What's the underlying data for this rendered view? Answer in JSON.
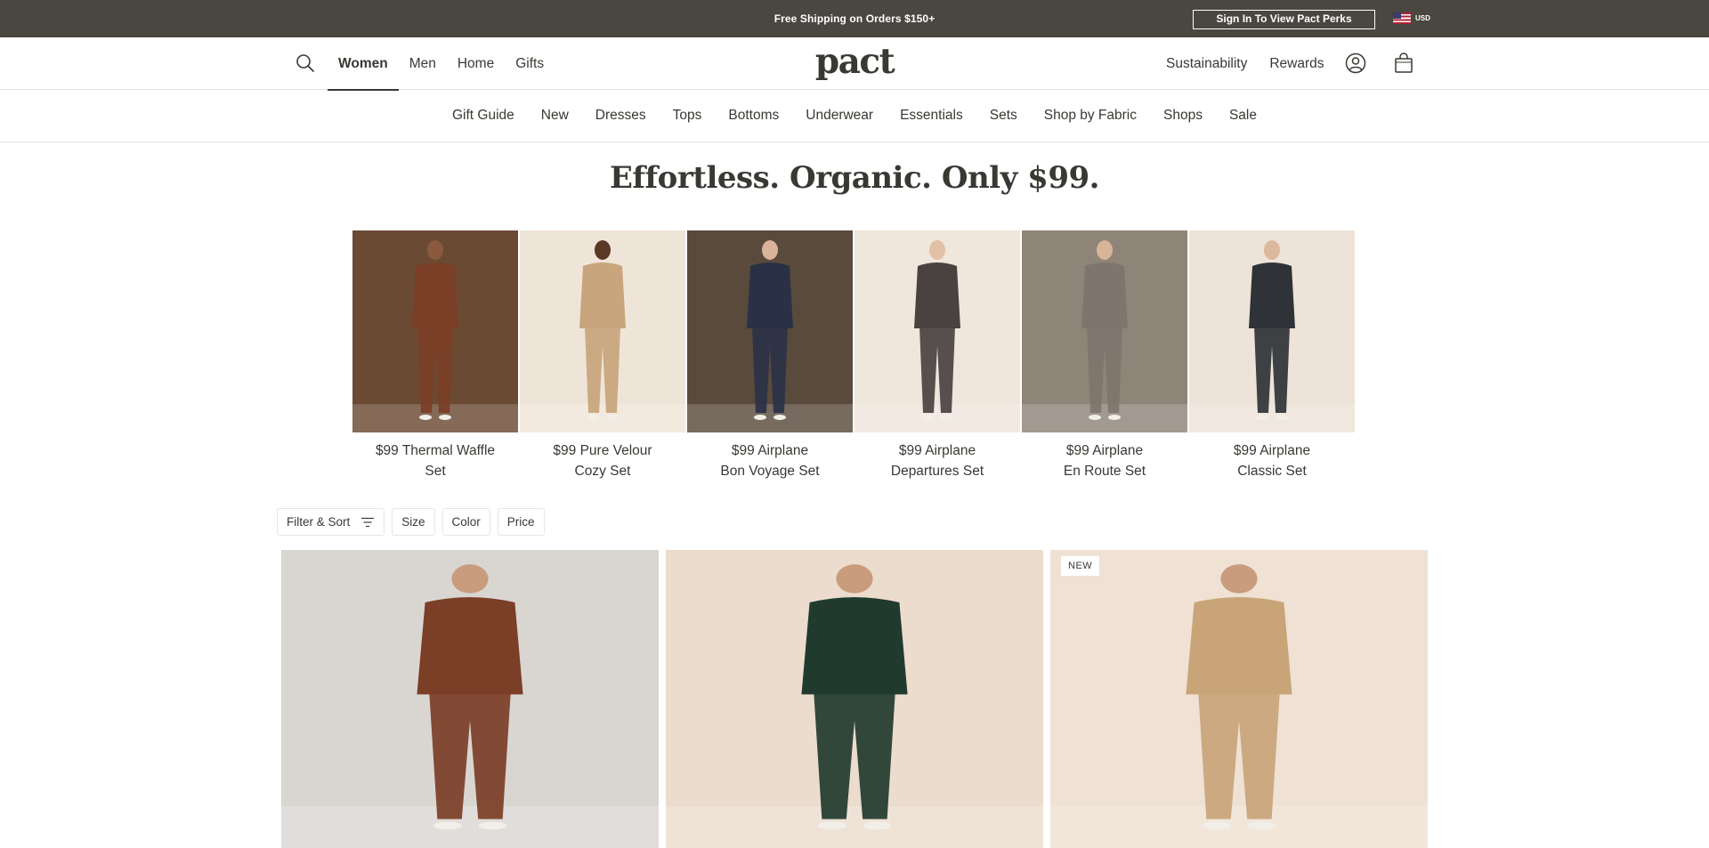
{
  "announcement": {
    "message": "Free Shipping on Orders $150+",
    "perks_button": "Sign In To View Pact Perks",
    "currency": "USD",
    "flag_icon": "us-flag-icon"
  },
  "header": {
    "logo": "pact",
    "main_nav": [
      {
        "label": "Women",
        "active": true
      },
      {
        "label": "Men",
        "active": false
      },
      {
        "label": "Home",
        "active": false
      },
      {
        "label": "Gifts",
        "active": false
      }
    ],
    "right_nav": [
      "Sustainability",
      "Rewards"
    ],
    "icons": {
      "search": "search-icon",
      "account": "account-icon",
      "cart": "shopping-bag-icon"
    }
  },
  "category_nav": [
    "Gift Guide",
    "New",
    "Dresses",
    "Tops",
    "Bottoms",
    "Underwear",
    "Essentials",
    "Sets",
    "Shop by Fabric",
    "Shops",
    "Sale"
  ],
  "hero": {
    "title": "Effortless. Organic. Only $99."
  },
  "features": [
    {
      "line1": "$99 Thermal Waffle",
      "line2": "Set",
      "bg": "#6a4a33",
      "outfit": "#7b3e26",
      "skin": "#8a5a3e"
    },
    {
      "line1": "$99 Pure Velour",
      "line2": "Cozy Set",
      "bg": "#efe4d8",
      "outfit": "#c8a57c",
      "skin": "#5a3826"
    },
    {
      "line1": "$99 Airplane",
      "line2": "Bon Voyage Set",
      "bg": "#5a4a3c",
      "outfit": "#2a3146",
      "skin": "#d9b49a"
    },
    {
      "line1": "$99 Airplane",
      "line2": "Departures Set",
      "bg": "#efe6dc",
      "outfit": "#4a4240",
      "skin": "#e2c0a4"
    },
    {
      "line1": "$99 Airplane",
      "line2": "En Route Set",
      "bg": "#8e8478",
      "outfit": "#7e756c",
      "skin": "#d8b498"
    },
    {
      "line1": "$99 Airplane",
      "line2": "Classic Set",
      "bg": "#ede3d8",
      "outfit": "#2f3337",
      "skin": "#dcb89c"
    }
  ],
  "filters": {
    "filter_sort": "Filter & Sort",
    "size": "Size",
    "color": "Color",
    "price": "Price"
  },
  "products": [
    {
      "badge": "",
      "bg": "#d9d6d2",
      "outfit": "#7b3e26"
    },
    {
      "badge": "",
      "bg": "#ecdcce",
      "outfit": "#213a2e"
    },
    {
      "badge": "NEW",
      "bg": "#efe1d4",
      "outfit": "#c9a478"
    }
  ],
  "colors": {
    "announcement_bg": "#4a4640",
    "text": "#3a3833",
    "divider": "#e6e3de"
  }
}
